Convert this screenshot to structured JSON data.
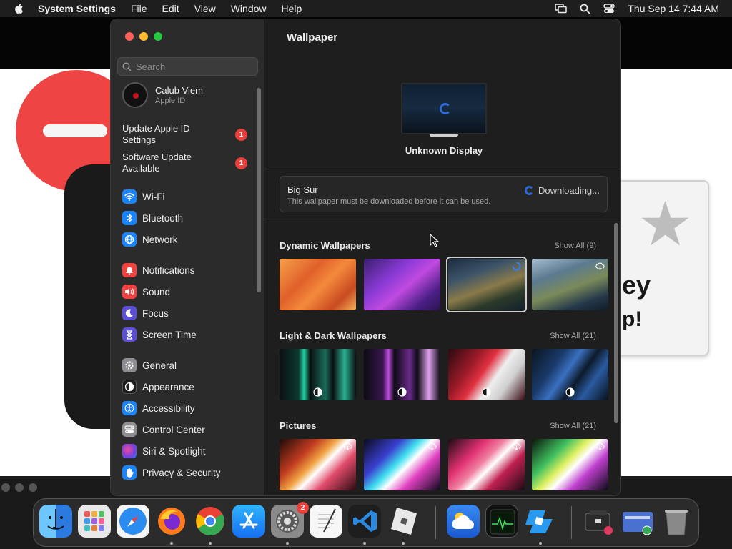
{
  "menubar": {
    "app_name": "System Settings",
    "items": [
      "File",
      "Edit",
      "View",
      "Window",
      "Help"
    ],
    "clock": "Thu Sep 14  7:44 AM"
  },
  "background": {
    "card_text_1": "ey",
    "card_text_2": "p!"
  },
  "sidebar": {
    "search_placeholder": "Search",
    "account": {
      "name": "Calub Viem",
      "subtitle": "Apple ID"
    },
    "notices": [
      {
        "label": "Update Apple ID Settings",
        "badge": "1"
      },
      {
        "label": "Software Update Available",
        "badge": "1"
      }
    ],
    "items": [
      {
        "label": "Wi-Fi",
        "icon": "wifi-icon",
        "color": "#1a84ff"
      },
      {
        "label": "Bluetooth",
        "icon": "bluetooth-icon",
        "color": "#1a84ff"
      },
      {
        "label": "Network",
        "icon": "globe-icon",
        "color": "#1a84ff"
      },
      {
        "label": "Notifications",
        "icon": "bell-icon",
        "color": "#f0423e"
      },
      {
        "label": "Sound",
        "icon": "speaker-icon",
        "color": "#f0423e"
      },
      {
        "label": "Focus",
        "icon": "moon-icon",
        "color": "#5b4fd6"
      },
      {
        "label": "Screen Time",
        "icon": "hourglass-icon",
        "color": "#5b4fd6"
      },
      {
        "label": "General",
        "icon": "gear-icon",
        "color": "#8e8e93"
      },
      {
        "label": "Appearance",
        "icon": "appearance-icon",
        "color": "#1c1c1c"
      },
      {
        "label": "Accessibility",
        "icon": "accessibility-icon",
        "color": "#1a84ff"
      },
      {
        "label": "Control Center",
        "icon": "control-center-icon",
        "color": "#8e8e93"
      },
      {
        "label": "Siri & Spotlight",
        "icon": "siri-icon",
        "color": "#7d3fd8"
      },
      {
        "label": "Privacy & Security",
        "icon": "hand-icon",
        "color": "#1a84ff"
      }
    ]
  },
  "main": {
    "title": "Wallpaper",
    "display_name": "Unknown Display",
    "current": {
      "name": "Big Sur",
      "description": "This wallpaper must be downloaded before it can be used.",
      "status": "Downloading..."
    },
    "sections": [
      {
        "title": "Dynamic Wallpapers",
        "show_all": "Show All (9)"
      },
      {
        "title": "Light & Dark Wallpapers",
        "show_all": "Show All (21)"
      },
      {
        "title": "Pictures",
        "show_all": "Show All (21)"
      }
    ]
  },
  "dock": {
    "apps": [
      "Finder",
      "Launchpad",
      "Safari",
      "Firefox",
      "Chrome",
      "App Store",
      "System Settings",
      "TextEdit",
      "Visual Studio Code",
      "Roblox",
      "Weather",
      "Activity Monitor",
      "Roblox Studio",
      "Downloads",
      "Applications",
      "Trash"
    ],
    "settings_badge": "2"
  }
}
